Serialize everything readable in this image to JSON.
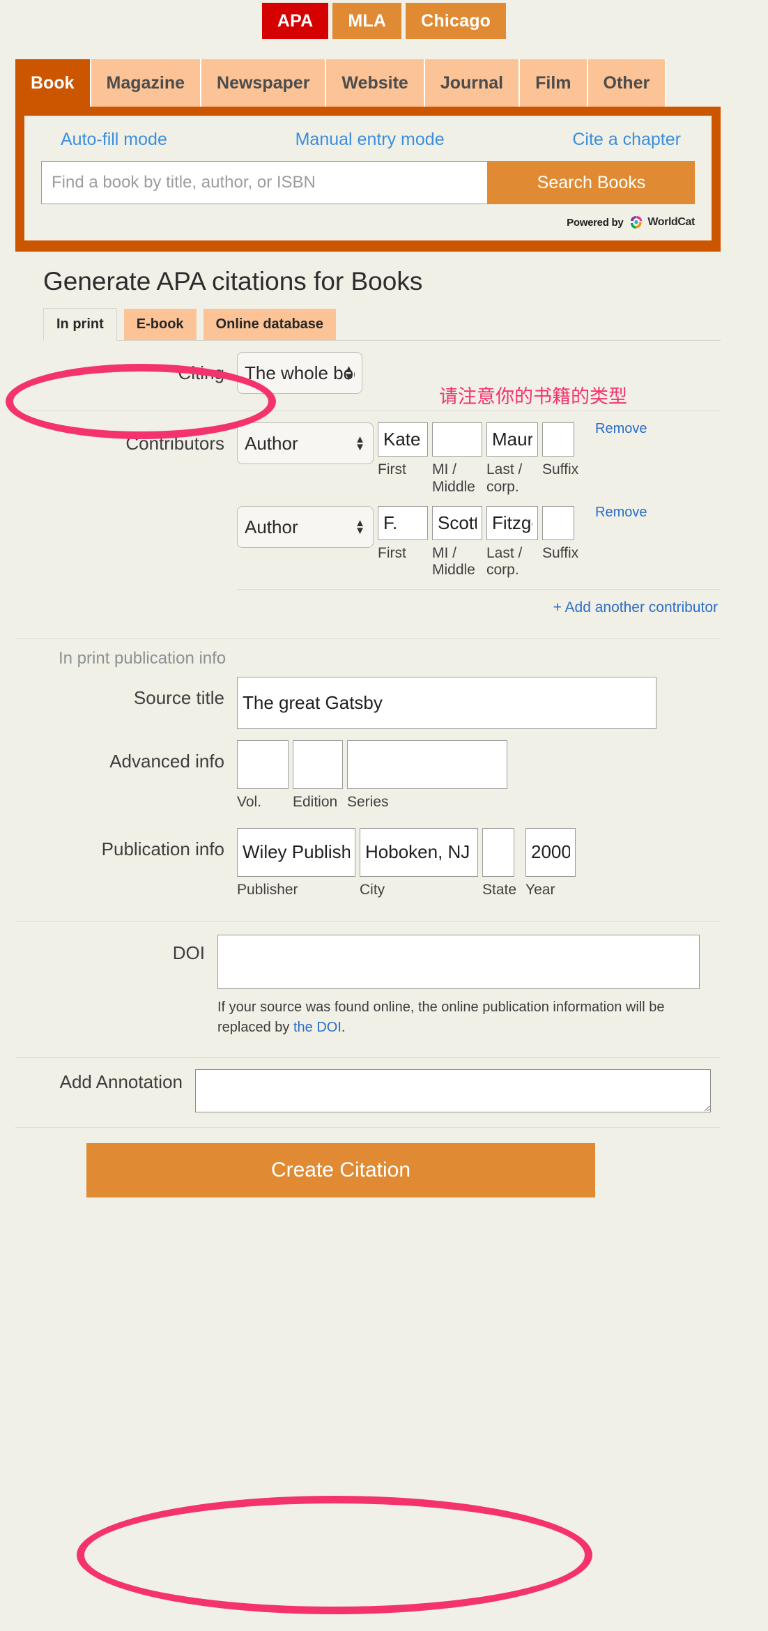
{
  "style_bar": {
    "options": [
      {
        "label": "APA",
        "active": true
      },
      {
        "label": "MLA",
        "active": false
      },
      {
        "label": "Chicago",
        "active": false
      }
    ]
  },
  "source_tabs": [
    {
      "label": "Book",
      "active": true
    },
    {
      "label": "Magazine",
      "active": false
    },
    {
      "label": "Newspaper",
      "active": false
    },
    {
      "label": "Website",
      "active": false
    },
    {
      "label": "Journal",
      "active": false
    },
    {
      "label": "Film",
      "active": false
    },
    {
      "label": "Other",
      "active": false
    }
  ],
  "autofill": {
    "mode_links": [
      "Auto-fill mode",
      "Manual entry mode",
      "Cite a chapter"
    ],
    "search_placeholder": "Find a book by title, author, or ISBN",
    "search_value": "",
    "search_button": "Search Books",
    "powered_by": "Powered by",
    "powered_brand": "WorldCat"
  },
  "form": {
    "title": "Generate APA citations for Books",
    "format_tabs": [
      {
        "label": "In print",
        "active": true
      },
      {
        "label": "E-book",
        "active": false
      },
      {
        "label": "Online database",
        "active": false
      }
    ],
    "citing": {
      "label": "Citing",
      "value": "The whole book"
    },
    "contributors": {
      "label": "Contributors",
      "captions": {
        "first": "First",
        "middle": "MI / Middle",
        "last": "Last / corp.",
        "suffix": "Suffix"
      },
      "remove_label": "Remove",
      "add_label": "+ Add another contributor",
      "rows": [
        {
          "type": "Author",
          "first": "Kate",
          "middle": "",
          "last": "Maurer",
          "suffix": ""
        },
        {
          "type": "Author",
          "first": "F.",
          "middle": "Scott.",
          "last": "Fitzgerald",
          "suffix": ""
        }
      ]
    },
    "publication_section_head": "In print publication info",
    "source_title": {
      "label": "Source title",
      "value": "The great Gatsby"
    },
    "advanced_info": {
      "label": "Advanced info",
      "vol": {
        "caption": "Vol.",
        "value": ""
      },
      "edition": {
        "caption": "Edition",
        "value": ""
      },
      "series": {
        "caption": "Series",
        "value": ""
      }
    },
    "publication_info": {
      "label": "Publication info",
      "publisher": {
        "caption": "Publisher",
        "value": "Wiley Publishing"
      },
      "city": {
        "caption": "City",
        "value": "Hoboken, NJ"
      },
      "state": {
        "caption": "State",
        "value": ""
      },
      "year": {
        "caption": "Year",
        "value": "2000"
      }
    },
    "doi": {
      "label": "DOI",
      "value": "",
      "note_prefix": "If your source was found online, the online publication information will be replaced by ",
      "note_link": "the DOI",
      "note_suffix": "."
    },
    "annotation": {
      "label": "Add Annotation",
      "value": ""
    },
    "create_button": "Create Citation"
  },
  "annotations": {
    "note_text": "请注意你的书籍的类型",
    "accent_color": "#f4336d"
  },
  "colors": {
    "page_bg": "#f1f0e7",
    "orange_dark": "#cc5500",
    "orange": "#e08b33",
    "orange_light": "#fbc396",
    "apa_red": "#d50000",
    "link_blue": "#2a6dc9",
    "mode_link_blue": "#3b8ede"
  }
}
